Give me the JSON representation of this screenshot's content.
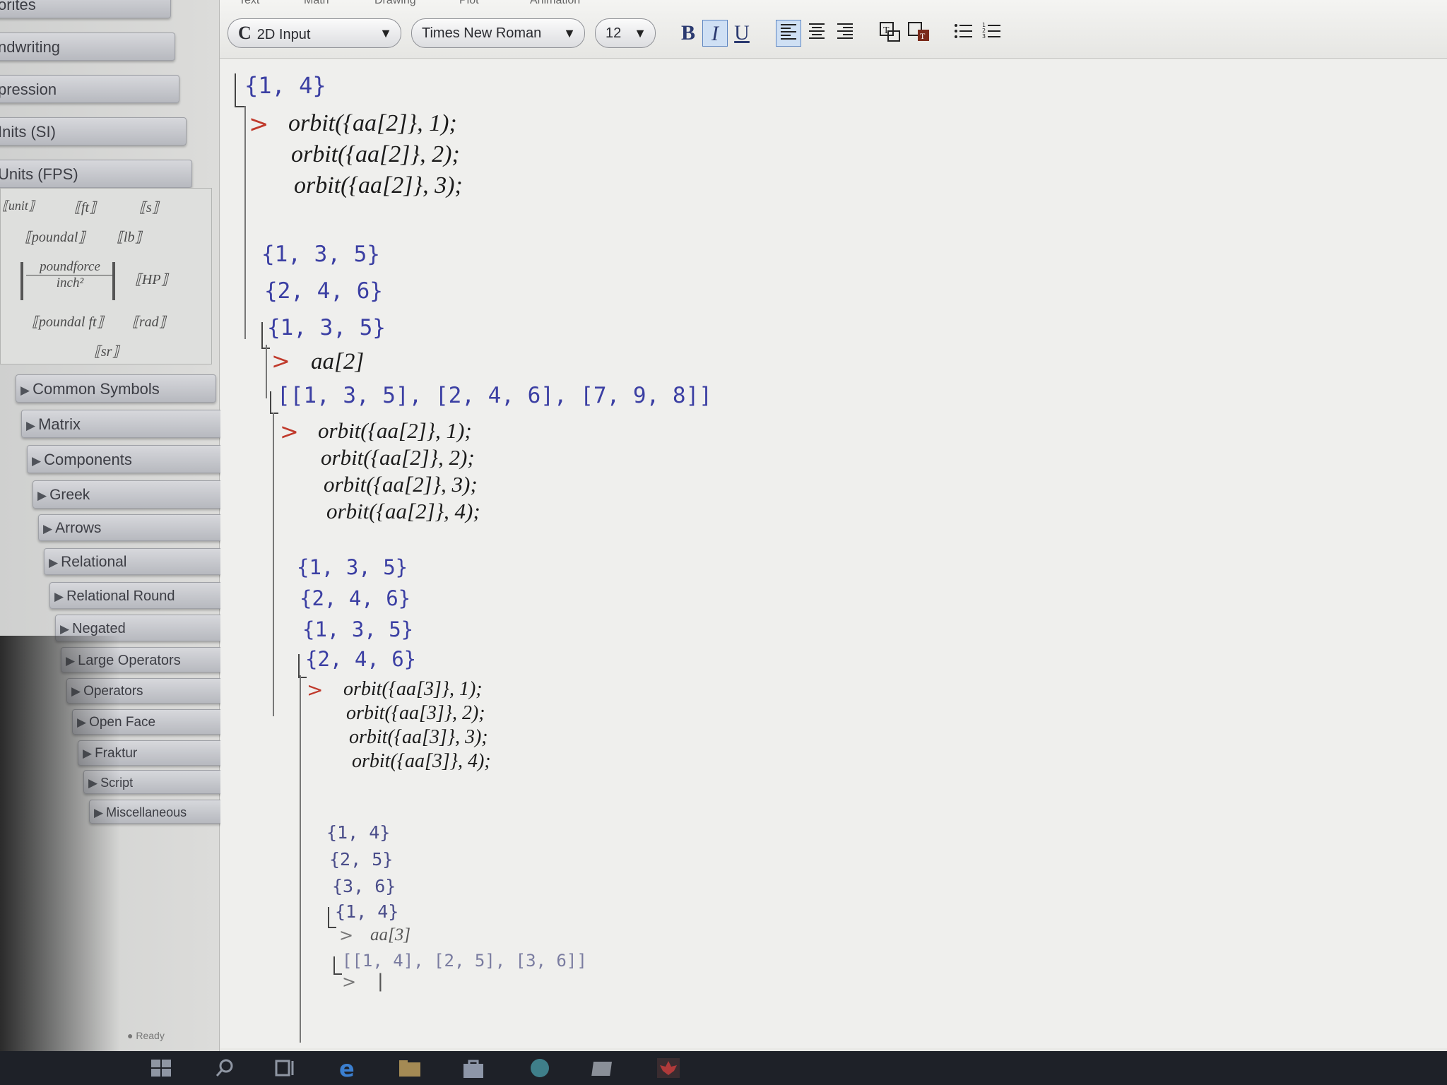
{
  "sidebar": {
    "headers": [
      {
        "label": "orites"
      },
      {
        "label": "ndwriting"
      },
      {
        "label": "pression"
      },
      {
        "label": "Inits (SI)"
      },
      {
        "label": "Units (FPS)"
      }
    ],
    "units": {
      "unit": "⟦unit⟧",
      "ft": "⟦ft⟧",
      "s": "⟦s⟧",
      "poundal": "⟦poundal⟧",
      "lb": "⟦lb⟧",
      "poundforce": "poundforce",
      "inch2": "inch²",
      "hp": "⟦HP⟧",
      "poundal_ft": "⟦poundal ft⟧",
      "rad": "⟦rad⟧",
      "sr": "⟦sr⟧"
    },
    "palettes": [
      "Common Symbols",
      "Matrix",
      "Components",
      "Greek",
      "Arrows",
      "Relational",
      "Relational Round",
      "Negated",
      "Large Operators",
      "Operators",
      "Open Face",
      "Fraktur",
      "Script",
      "Miscellaneous"
    ],
    "arrow_glyph": "▶"
  },
  "toolbar": {
    "tabs": [
      "Text",
      "Math",
      "Drawing",
      "Plot",
      "Animation"
    ],
    "input_mode": "2D Input",
    "input_mode_icon": "C",
    "font": "Times New Roman",
    "size": "12",
    "bold": "B",
    "italic": "I",
    "underline": "U"
  },
  "worksheet": {
    "top_output": "{1, 4}",
    "block1": {
      "inputs": [
        "orbit({aa[2]}, 1);",
        "orbit({aa[2]}, 2);",
        "orbit({aa[2]}, 3);"
      ],
      "outputs": [
        "{1, 3, 5}",
        "{2, 4, 6}",
        "{1, 3, 5}"
      ]
    },
    "block2": {
      "input": "aa[2]",
      "output": "[[1, 3, 5], [2, 4, 6], [7, 9, 8]]"
    },
    "block3": {
      "inputs": [
        "orbit({aa[2]}, 1);",
        "orbit({aa[2]}, 2);",
        "orbit({aa[2]}, 3);",
        "orbit({aa[2]}, 4);"
      ],
      "outputs": [
        "{1, 3, 5}",
        "{2, 4, 6}",
        "{1, 3, 5}",
        "{2, 4, 6}"
      ]
    },
    "block4": {
      "inputs": [
        "orbit({aa[3]}, 1);",
        "orbit({aa[3]}, 2);",
        "orbit({aa[3]}, 3);",
        "orbit({aa[3]}, 4);"
      ],
      "outputs": [
        "{1, 4}",
        "{2, 5}",
        "{3, 6}",
        "{1, 4}"
      ]
    },
    "block5": {
      "input": "aa[3]",
      "output": "[[1, 4], [2, 5], [3, 6]]"
    },
    "prompt_glyph": ">",
    "cursor": "|"
  },
  "status": {
    "text": "Ready"
  },
  "colors": {
    "prompt": "#c0392b",
    "output": "#3b3fa3",
    "input": "#1b1b1b"
  }
}
